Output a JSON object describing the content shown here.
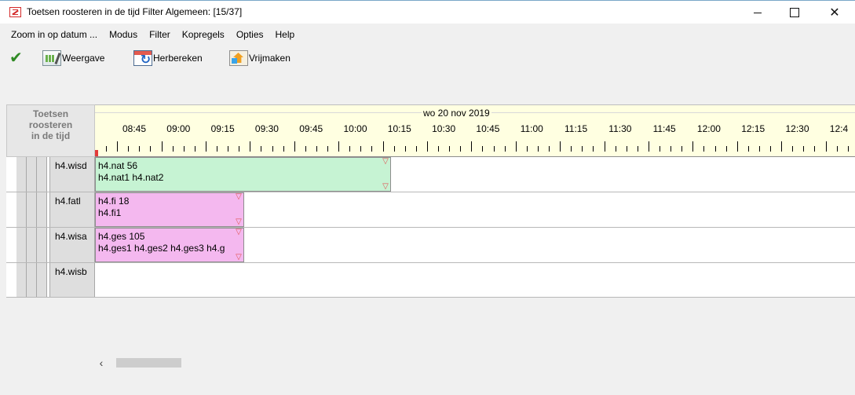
{
  "window": {
    "title": "Toetsen roosteren in de tijd  Filter Algemeen: [15/37]",
    "close_glyph": "✕",
    "app_icon": "roster-app-icon"
  },
  "menu": [
    "Zoom in op datum ...",
    "Modus",
    "Filter",
    "Kopregels",
    "Opties",
    "Help"
  ],
  "toolbar": {
    "weergave_label": "Weergave",
    "herbereken_label": "Herbereken",
    "vrijmaken_label": "Vrijmaken"
  },
  "panel": {
    "title_line1": "Toetsen",
    "title_line2": "roosteren",
    "title_line3": "in de tijd"
  },
  "timeline": {
    "date": "wo 20 nov 2019",
    "times": [
      "08:45",
      "09:00",
      "09:15",
      "09:30",
      "09:45",
      "10:00",
      "10:15",
      "10:30",
      "10:45",
      "11:00",
      "11:15",
      "11:30",
      "11:45",
      "12:00",
      "12:15",
      "12:30",
      "12:4"
    ]
  },
  "rows": [
    {
      "label": "h4.wisd",
      "block_line1": "h4.nat 56",
      "block_line2": "h4.nat1 h4.nat2",
      "block_color": "#c6f3d3"
    },
    {
      "label": "h4.fatl",
      "block_line1": "h4.fi 18",
      "block_line2": "h4.fi1",
      "block_color": "#f4b8ef"
    },
    {
      "label": "h4.wisa",
      "block_line1": "h4.ges 105",
      "block_line2": "h4.ges1 h4.ges2 h4.ges3 h4.g",
      "block_color": "#f4b8ef"
    },
    {
      "label": "h4.wisb"
    }
  ],
  "scrollbar": {
    "left_arrow": "‹"
  }
}
